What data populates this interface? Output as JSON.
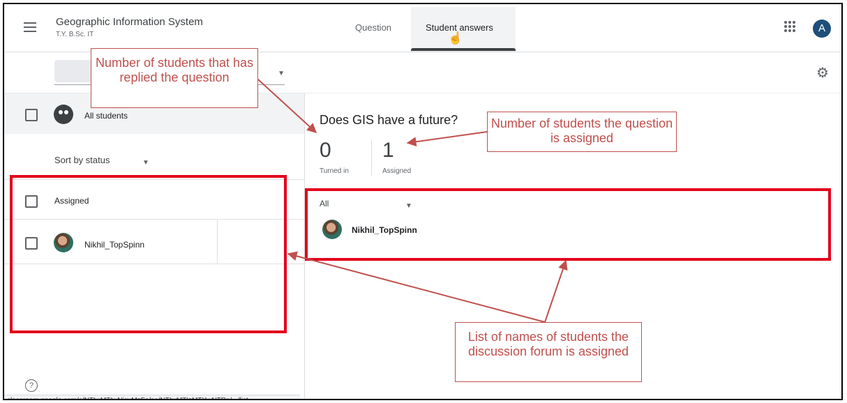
{
  "header": {
    "class_title": "Geographic Information System",
    "class_subtitle": "T.Y. B.Sc. IT",
    "tabs": [
      {
        "label": "Question"
      },
      {
        "label": "Student answers"
      }
    ],
    "profile_initial": "A"
  },
  "sidebar": {
    "all_students_label": "All students",
    "sort_label": "Sort by status",
    "group_label": "Assigned",
    "students": [
      {
        "name": "Nikhil_TopSpinn"
      }
    ]
  },
  "main": {
    "question_title": "Does GIS have a future?",
    "stats": {
      "turned_in": {
        "value": "0",
        "label": "Turned in"
      },
      "assigned": {
        "value": "1",
        "label": "Assigned"
      }
    },
    "filter_label": "All",
    "students": [
      {
        "name": "Nikhil_TopSpinn"
      }
    ]
  },
  "status_bar": {
    "url": "classroom.google.com/c/NTIwMTIwNjgyMzFa/sa/NTIwMTIzMTYwNTRa/.../list"
  },
  "annotations": {
    "replied_callout": "Number of students that has replied the question",
    "assigned_callout": "Number of students the question is assigned",
    "list_callout": "List of names of students the discussion forum is assigned"
  },
  "colors": {
    "annotation_text": "#c0504d",
    "highlight_box": "#e3001b",
    "avatar_bg": "#1f4e79"
  },
  "icons": [
    "menu-icon",
    "apps-grid-icon",
    "settings-gear-icon",
    "group-icon",
    "help-icon",
    "pointer-hand-icon",
    "dropdown-caret-icon"
  ]
}
